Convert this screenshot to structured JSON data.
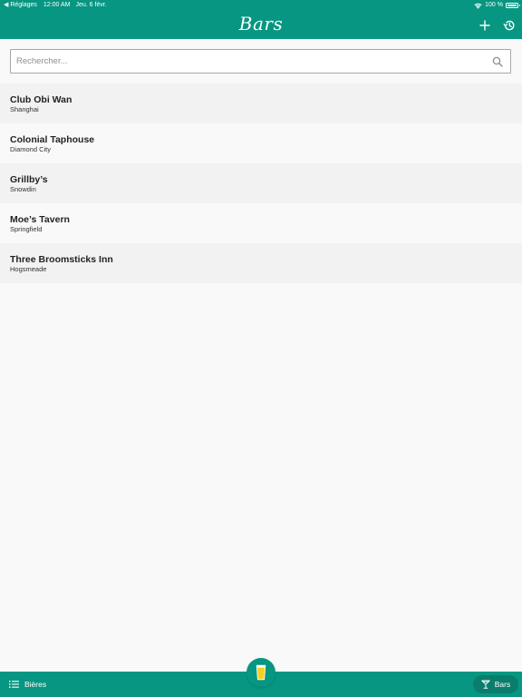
{
  "status_bar": {
    "back_label": "◀ Réglages",
    "time": "12:00 AM",
    "date": "Jeu. 6 févr.",
    "battery": "100 %"
  },
  "nav": {
    "title": "Bars",
    "add_icon": "plus-icon",
    "history_icon": "history-icon"
  },
  "search": {
    "placeholder": "Rechercher..."
  },
  "bars": [
    {
      "name": "Club Obi Wan",
      "city": "Shanghai"
    },
    {
      "name": "Colonial Taphouse",
      "city": "Diamond City"
    },
    {
      "name": "Grillby’s",
      "city": "Snowdin"
    },
    {
      "name": "Moe’s Tavern",
      "city": "Springfield"
    },
    {
      "name": "Three Broomsticks Inn",
      "city": "Hogsmeade"
    }
  ],
  "tabs": {
    "left_label": "Bières",
    "right_label": "Bars"
  },
  "colors": {
    "primary": "#079681",
    "accent": "#f5d020"
  }
}
